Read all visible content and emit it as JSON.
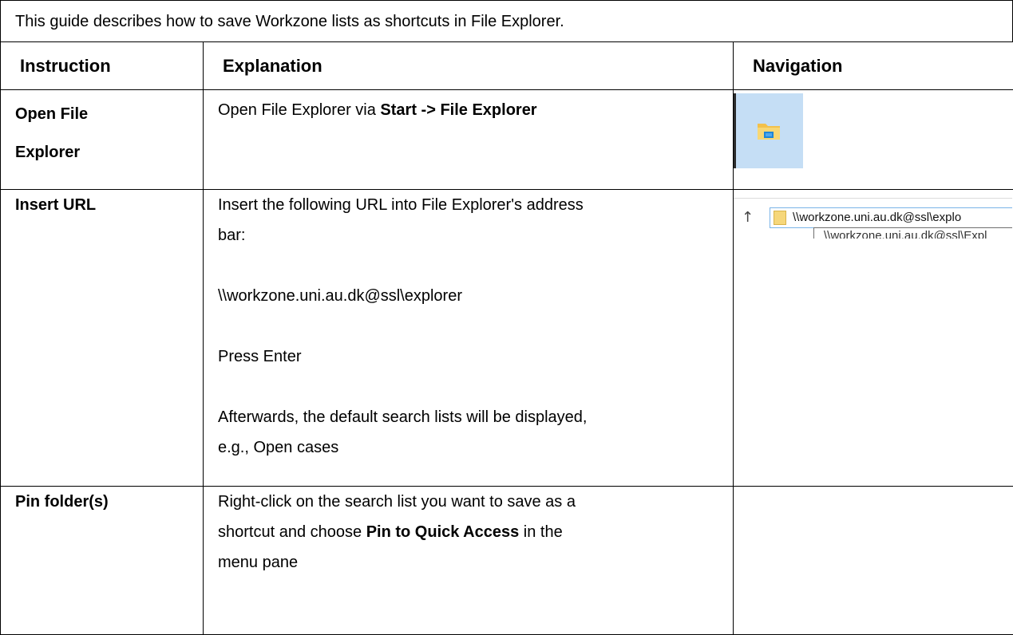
{
  "intro_text": "This guide describes how to save Workzone lists as shortcuts in File Explorer.",
  "headers": {
    "instruction": "Instruction",
    "explanation": "Explanation",
    "navigation": "Navigation"
  },
  "rows": [
    {
      "instruction_line1": "Open File",
      "instruction_line2": "Explorer",
      "explanation_prefix": "Open File Explorer via ",
      "explanation_bold": "Start -> File Explorer",
      "navigation_icon": "file-explorer-icon"
    },
    {
      "instruction": "Insert URL",
      "explanation_line1": "Insert the following URL into File Explorer's address",
      "explanation_line2": "bar:",
      "url": "\\\\workzone.uni.au.dk@ssl\\explorer",
      "press": "Press Enter",
      "after_line1": "Afterwards, the default search lists will be displayed,",
      "after_line2": "e.g., Open cases",
      "navigation": {
        "address_text": "\\\\workzone.uni.au.dk@ssl\\explo",
        "dropdown_text": "\\\\workzone.uni.au.dk@ssl\\Expl"
      }
    },
    {
      "instruction": "Pin folder(s)",
      "explanation_line1": "Right-click on the search list you want to save as a",
      "explanation_line2_prefix": "shortcut and choose ",
      "explanation_line2_bold": "Pin to Quick Access",
      "explanation_line2_suffix": " in the",
      "explanation_line3": "menu pane"
    }
  ]
}
